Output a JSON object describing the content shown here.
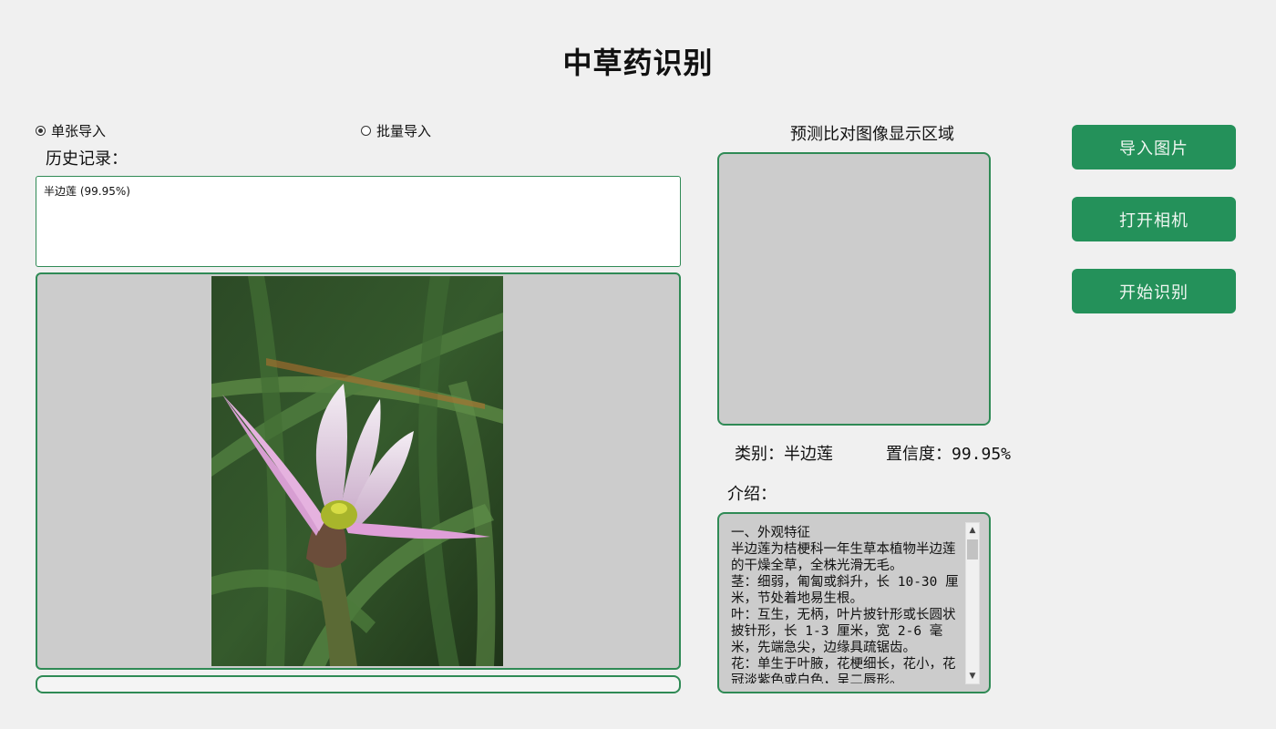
{
  "app": {
    "title": "中草药识别"
  },
  "import_mode": {
    "options": [
      {
        "label": "单张导入",
        "selected": true
      },
      {
        "label": "批量导入",
        "selected": false
      }
    ]
  },
  "history": {
    "label": "历史记录：",
    "entries": [
      "半边莲 (99.95%)"
    ]
  },
  "compare": {
    "label": "预测比对图像显示区域"
  },
  "result": {
    "category_label": "类别：",
    "category_value": "半边莲",
    "confidence_label": "置信度：",
    "confidence_value": "99.95%"
  },
  "intro": {
    "label": "介绍：",
    "text": "一、外观特征\n半边莲为桔梗科一年生草本植物半边莲的干燥全草，全株光滑无毛。\n茎：细弱，匍匐或斜升，长 10-30 厘米，节处着地易生根。\n叶：互生，无柄，叶片披针形或长圆状披针形，长 1-3 厘米，宽 2-6 毫米，先端急尖，边缘具疏锯齿。\n花：单生于叶腋，花梗细长，花小，花冠淡紫色或白色，呈二唇形。"
  },
  "buttons": {
    "import_image": "导入图片",
    "open_camera": "打开相机",
    "start_recognition": "开始识别"
  },
  "colors": {
    "accent_green": "#24915a",
    "panel_border": "#2f8a55",
    "panel_gray": "#cccccc",
    "background": "#f0f0f0"
  },
  "progress": {
    "value": 0
  }
}
